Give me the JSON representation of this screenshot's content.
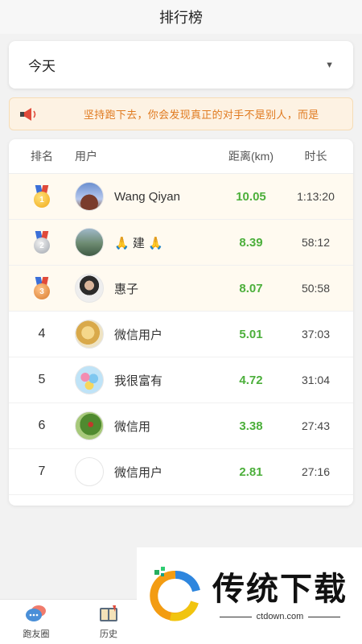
{
  "header": {
    "title": "排行榜"
  },
  "selector": {
    "value": "今天"
  },
  "notice": {
    "text": "坚持跑下去，你会发现真正的对手不是别人，而是"
  },
  "table": {
    "columns": [
      "排名",
      "用户",
      "距离(km)",
      "时长"
    ],
    "rows": [
      {
        "rank": "1",
        "medal": "gold",
        "name": "Wang Qiyan",
        "distance": "10.05",
        "duration": "1:13:20"
      },
      {
        "rank": "2",
        "medal": "silver",
        "name": "🙏 建 🙏",
        "distance": "8.39",
        "duration": "58:12"
      },
      {
        "rank": "3",
        "medal": "bronze",
        "name": "惠子",
        "distance": "8.07",
        "duration": "50:58"
      },
      {
        "rank": "4",
        "name": "微信用户",
        "distance": "5.01",
        "duration": "37:03"
      },
      {
        "rank": "5",
        "name": "我很富有",
        "distance": "4.72",
        "duration": "31:04"
      },
      {
        "rank": "6",
        "name": "微信用",
        "distance": "3.38",
        "duration": "27:43"
      },
      {
        "rank": "7",
        "name": "微信用户",
        "distance": "2.81",
        "duration": "27:16"
      }
    ]
  },
  "tabbar": {
    "items": [
      {
        "label": "跑友圈",
        "icon": "chat-bubbles-icon"
      },
      {
        "label": "历史",
        "icon": "book-icon"
      }
    ]
  },
  "watermark": {
    "title": "传统下载",
    "site": "ctdown.com"
  },
  "colors": {
    "distance": "#4caf3b",
    "notice_text": "#e07a1f",
    "notice_bg": "#fdf2e3",
    "top3_bg": "#fffaf0"
  }
}
